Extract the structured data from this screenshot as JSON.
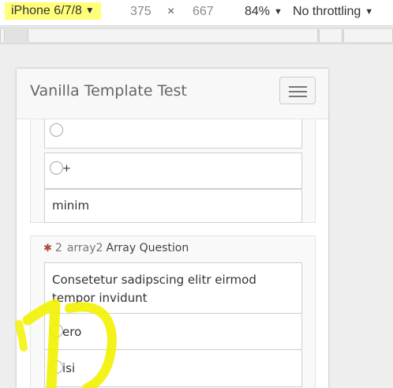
{
  "devtools": {
    "device": "iPhone 6/7/8",
    "width": "375",
    "times": "×",
    "height": "667",
    "zoom": "84%",
    "throttling": "No throttling",
    "arrow": "▼"
  },
  "page": {
    "brand": "Vanilla Template Test"
  },
  "question1": {
    "options": [
      "",
      "+",
      "minim"
    ]
  },
  "question2": {
    "required_mark": "✱",
    "number": "2",
    "code": "array2",
    "title": "Array Question",
    "text": "Consetetur sadipscing elitr eirmod tempor invidunt",
    "options": [
      "ero",
      "isi"
    ]
  },
  "colors": {
    "highlight": "#ffff7a",
    "scribble": "#f2f200",
    "required": "#a94442"
  }
}
